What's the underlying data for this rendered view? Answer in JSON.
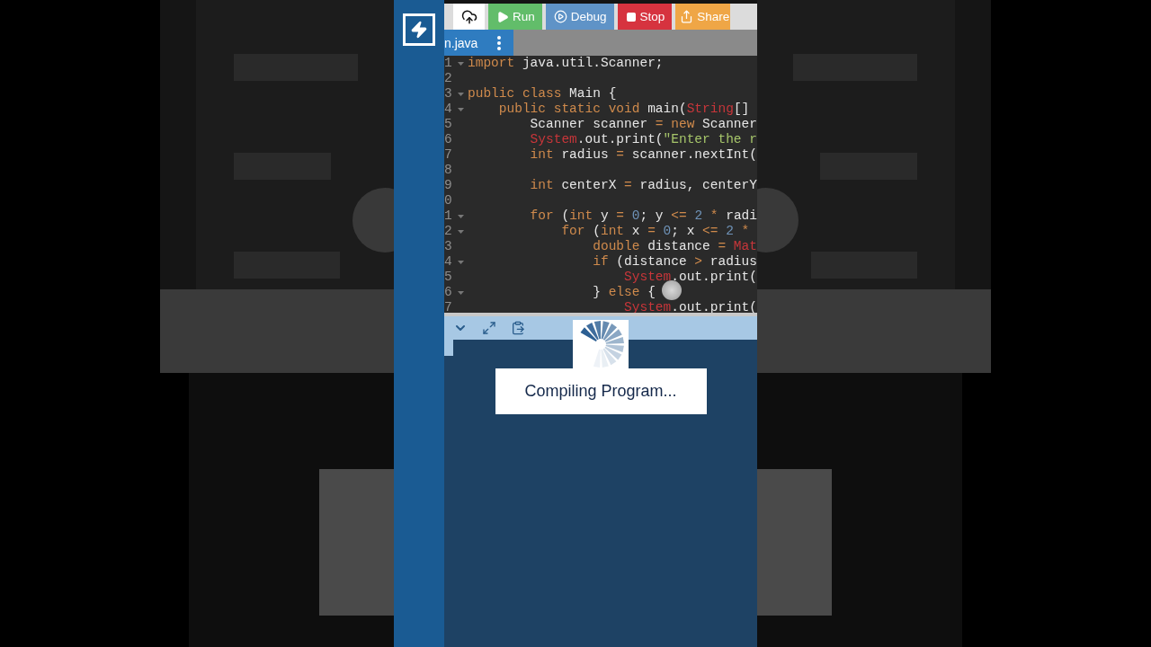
{
  "toolbar": {
    "buttons": [
      {
        "kind": "upload"
      },
      {
        "kind": "run",
        "label": "Run"
      },
      {
        "kind": "debug",
        "label": "Debug"
      },
      {
        "kind": "stop",
        "label": "Stop"
      },
      {
        "kind": "share",
        "label": "Share"
      }
    ]
  },
  "file_tab": {
    "label": "n.java"
  },
  "editor": {
    "lines": [
      {
        "number": "1",
        "fold": true,
        "tokens": [
          {
            "kind": "kw",
            "text": "import"
          },
          {
            "kind": "plain",
            "text": " java.util.Scanner;"
          }
        ]
      },
      {
        "number": "2",
        "fold": false
      },
      {
        "number": "3",
        "fold": true,
        "tokens": [
          {
            "kind": "kw",
            "text": "public class"
          },
          {
            "kind": "plain",
            "text": " Main {"
          }
        ]
      },
      {
        "number": "4",
        "fold": true,
        "tokens": [
          {
            "kind": "kw",
            "text": "    public static void"
          },
          {
            "kind": "plain",
            "text": " main("
          },
          {
            "kind": "type",
            "text": "String"
          },
          {
            "kind": "plain",
            "text": "[]"
          }
        ]
      },
      {
        "number": "5",
        "fold": false,
        "tokens": [
          {
            "kind": "plain",
            "text": "        Scanner scanner "
          },
          {
            "kind": "op",
            "text": "= "
          },
          {
            "kind": "kw",
            "text": "new"
          },
          {
            "kind": "plain",
            "text": " Scanner"
          }
        ]
      },
      {
        "number": "6",
        "fold": false,
        "tokens": [
          {
            "kind": "type",
            "text": "        System"
          },
          {
            "kind": "plain",
            "text": ".out.print("
          },
          {
            "kind": "str",
            "text": "\"Enter the r"
          }
        ]
      },
      {
        "number": "7",
        "fold": false,
        "tokens": [
          {
            "kind": "kw",
            "text": "        int"
          },
          {
            "kind": "plain",
            "text": " radius "
          },
          {
            "kind": "op",
            "text": "="
          },
          {
            "kind": "plain",
            "text": " scanner.nextInt("
          }
        ]
      },
      {
        "number": "8",
        "fold": false
      },
      {
        "number": "9",
        "fold": false,
        "tokens": [
          {
            "kind": "kw",
            "text": "        int"
          },
          {
            "kind": "plain",
            "text": " centerX "
          },
          {
            "kind": "op",
            "text": "="
          },
          {
            "kind": "plain",
            "text": " radius, centerY"
          }
        ]
      },
      {
        "number": "0",
        "fold": false
      },
      {
        "number": "1",
        "fold": true,
        "tokens": [
          {
            "kind": "kw",
            "text": "        for"
          },
          {
            "kind": "plain",
            "text": " ("
          },
          {
            "kind": "kw",
            "text": "int"
          },
          {
            "kind": "plain",
            "text": " y "
          },
          {
            "kind": "op",
            "text": "= "
          },
          {
            "kind": "num",
            "text": "0"
          },
          {
            "kind": "plain",
            "text": "; y "
          },
          {
            "kind": "op",
            "text": "<= "
          },
          {
            "kind": "num",
            "text": "2 "
          },
          {
            "kind": "op",
            "text": "*"
          },
          {
            "kind": "plain",
            "text": " radi"
          }
        ]
      },
      {
        "number": "2",
        "fold": true,
        "tokens": [
          {
            "kind": "kw",
            "text": "            for"
          },
          {
            "kind": "plain",
            "text": " ("
          },
          {
            "kind": "kw",
            "text": "int"
          },
          {
            "kind": "plain",
            "text": " x "
          },
          {
            "kind": "op",
            "text": "= "
          },
          {
            "kind": "num",
            "text": "0"
          },
          {
            "kind": "plain",
            "text": "; x "
          },
          {
            "kind": "op",
            "text": "<= "
          },
          {
            "kind": "num",
            "text": "2 "
          },
          {
            "kind": "op",
            "text": "*"
          }
        ]
      },
      {
        "number": "3",
        "fold": false,
        "tokens": [
          {
            "kind": "kw",
            "text": "                double"
          },
          {
            "kind": "plain",
            "text": " distance "
          },
          {
            "kind": "op",
            "text": "= "
          },
          {
            "kind": "type",
            "text": "Mat"
          }
        ]
      },
      {
        "number": "4",
        "fold": true,
        "tokens": [
          {
            "kind": "kw",
            "text": "                if"
          },
          {
            "kind": "plain",
            "text": " (distance "
          },
          {
            "kind": "op",
            "text": ">"
          },
          {
            "kind": "plain",
            "text": " radius"
          }
        ]
      },
      {
        "number": "5",
        "fold": false,
        "tokens": [
          {
            "kind": "type",
            "text": "                    System"
          },
          {
            "kind": "plain",
            "text": ".out.print("
          }
        ]
      },
      {
        "number": "6",
        "fold": true,
        "tokens": [
          {
            "kind": "plain",
            "text": "                } "
          },
          {
            "kind": "kw",
            "text": "else"
          },
          {
            "kind": "plain",
            "text": " {"
          }
        ]
      },
      {
        "number": "7",
        "fold": false,
        "tokens": [
          {
            "kind": "type",
            "text": "                    System"
          },
          {
            "kind": "plain",
            "text": ".out.print("
          }
        ]
      }
    ]
  },
  "console": {
    "message": "Compiling Program..."
  }
}
